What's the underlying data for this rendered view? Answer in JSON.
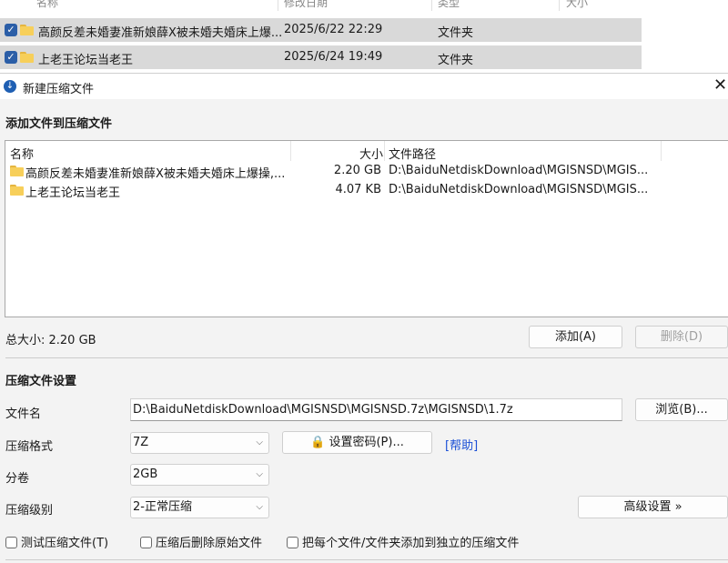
{
  "explorer": {
    "headers": [
      "名称",
      "修改日期",
      "类型",
      "大小"
    ],
    "rows": [
      {
        "name": "高颜反差未婚妻准新娘薛X被未婚夫婚床上爆...",
        "date": "2025/6/22 22:29",
        "type": "文件夹"
      },
      {
        "name": "上老王论坛当老王",
        "date": "2025/6/24 19:49",
        "type": "文件夹"
      }
    ]
  },
  "dialog": {
    "title": "新建压缩文件",
    "close_glyph": "✕",
    "add_section_title": "添加文件到压缩文件",
    "list_headers": {
      "name": "名称",
      "size": "大小",
      "path": "文件路径"
    },
    "files": [
      {
        "name": "高颜反差未婚妻准新娘薛X被未婚夫婚床上爆操,...",
        "size": "2.20 GB",
        "path": "D:\\BaiduNetdiskDownload\\MGISNSD\\MGIS..."
      },
      {
        "name": "上老王论坛当老王",
        "size": "4.07 KB",
        "path": "D:\\BaiduNetdiskDownload\\MGISNSD\\MGIS..."
      }
    ],
    "total_size": "总大小: 2.20 GB",
    "add_button": "添加(A)",
    "delete_button": "删除(D)",
    "settings_title": "压缩文件设置",
    "filename_label": "文件名",
    "filename_value": "D:\\BaiduNetdiskDownload\\MGISNSD\\MGISNSD.7z\\MGISNSD\\1.7z",
    "browse_button": "浏览(B)...",
    "format_label": "压缩格式",
    "format_value": "7Z",
    "password_button": "设置密码(P)...",
    "help_link": "[帮助]",
    "volume_label": "分卷",
    "volume_value": "2GB",
    "level_label": "压缩级别",
    "level_value": "2-正常压缩",
    "advanced_button": "高级设置 »",
    "checks": [
      "测试压缩文件(T)",
      "压缩后删除原始文件",
      "把每个文件/文件夹添加到独立的压缩文件"
    ]
  },
  "colors": {
    "selection": "#d9d9d9",
    "checkbox": "#2b5ea7",
    "folder": "#f7cf5a",
    "link": "#1a4fd6",
    "app_icon": "#1f5fb3"
  }
}
